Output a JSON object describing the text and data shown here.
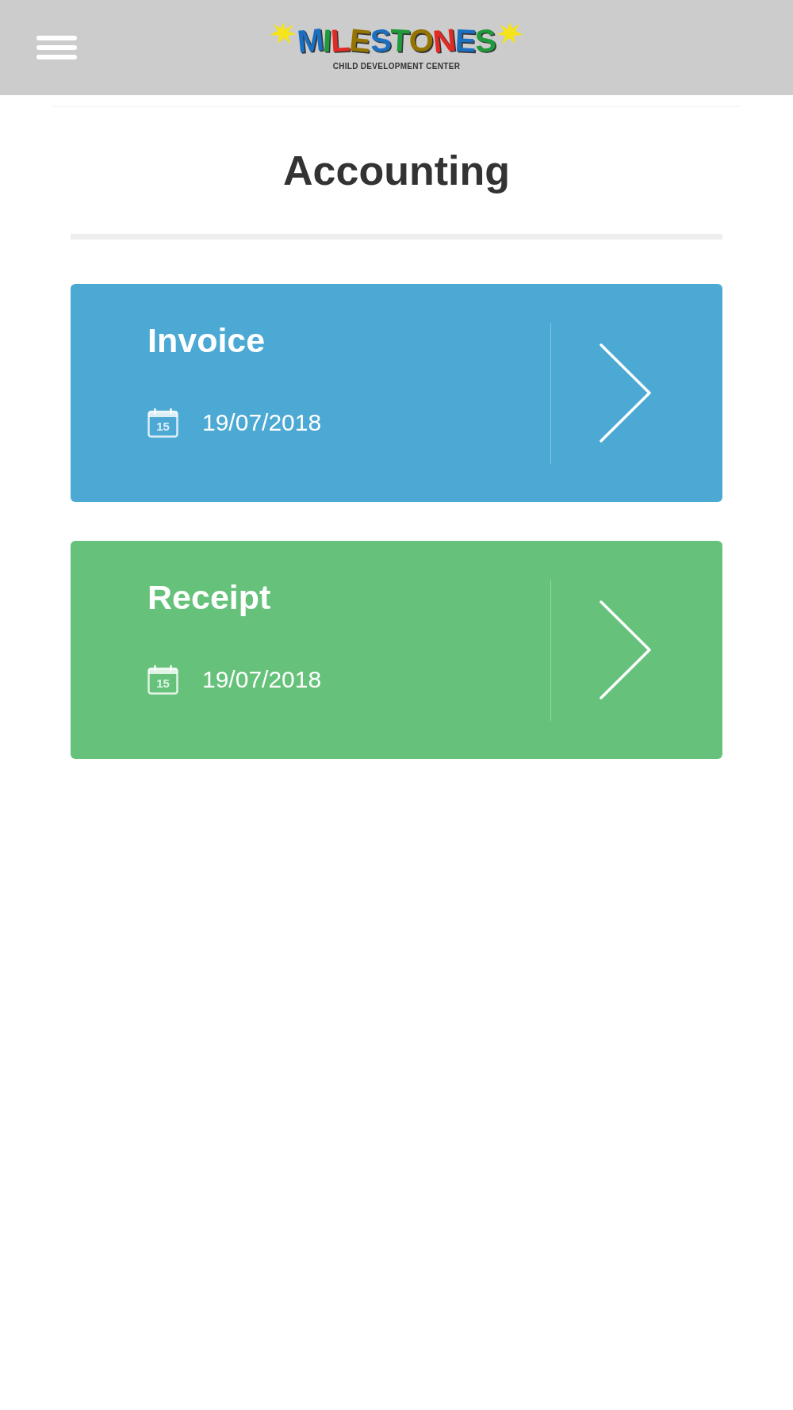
{
  "header": {
    "logo": {
      "wordmark": "MILESTONES",
      "tagline": "CHILD DEVELOPMENT CENTER"
    }
  },
  "page_title": "Accounting",
  "cards": [
    {
      "title": "Invoice",
      "date": "19/07/2018",
      "calendar_day": "15",
      "color": "#4ba9d4"
    },
    {
      "title": "Receipt",
      "date": "19/07/2018",
      "calendar_day": "15",
      "color": "#66c27a"
    }
  ]
}
